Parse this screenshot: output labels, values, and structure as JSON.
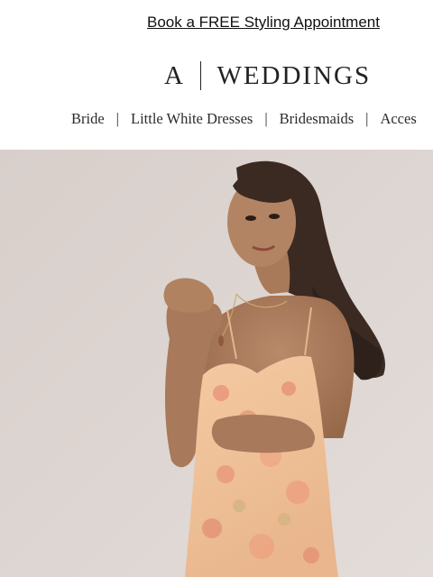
{
  "promo": {
    "text": "Book a FREE Styling Appointment"
  },
  "logo": {
    "left": "A",
    "right": "WEDDINGS"
  },
  "nav": {
    "items": [
      {
        "label": "Bride"
      },
      {
        "label": "Little White Dresses"
      },
      {
        "label": "Bridesmaids"
      },
      {
        "label": "Acces"
      }
    ],
    "separator": "|"
  },
  "colors": {
    "background": "#ffffff",
    "hero_backdrop": "#dcd3cf",
    "dress_base": "#f2c39a",
    "text": "#1a1a1a"
  }
}
